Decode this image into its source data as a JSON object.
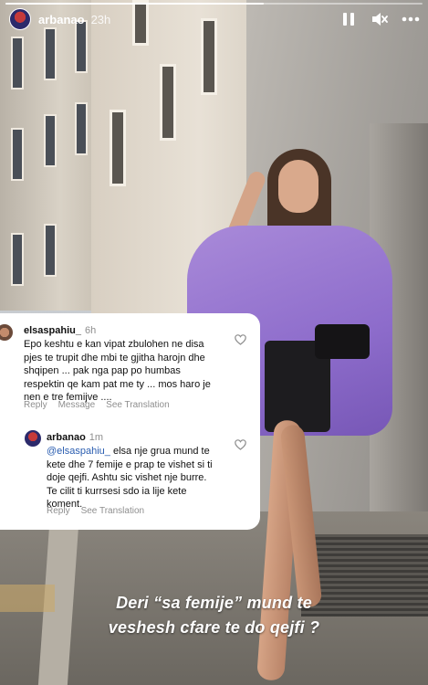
{
  "story": {
    "progress": 0.62,
    "username": "arbanao",
    "time": "23h"
  },
  "comments": [
    {
      "username": "elsaspahiu_",
      "time": "6h",
      "lines": [
        "Epo keshtu e kan vipat zbulohen ne disa",
        "pjes te trupit dhe mbi te gjitha harojn dhe",
        "shqipen ... pak nga pap po humbas",
        "respektin qe kam pat me ty ... mos haro je",
        "nen e tre femijve ...."
      ],
      "reply": "Reply",
      "message": "Message",
      "see_translation": "See Translation"
    },
    {
      "username": "arbanao",
      "time": "1m",
      "mention": "@elsaspahiu_",
      "first_line_rest": " elsa nje grua mund te",
      "lines": [
        "kete dhe 7 femije e prap te vishet si ti",
        "doje qejfi. Ashtu sic vishet nje burre.",
        "Te cilit ti kurrsesi sdo ia lije kete",
        "koment."
      ],
      "reply": "Reply",
      "see_translation": "See Translation"
    }
  ],
  "caption": {
    "line1": "Deri “sa femije” mund te",
    "line2": "veshesh cfare te do qejfi ?"
  },
  "colors": {
    "shirt": "#8d6ccb",
    "link": "#2a5db0",
    "muted": "#8e8e8e"
  },
  "icons": [
    "pause-icon",
    "mute-icon",
    "more-icon",
    "heart-icon"
  ]
}
